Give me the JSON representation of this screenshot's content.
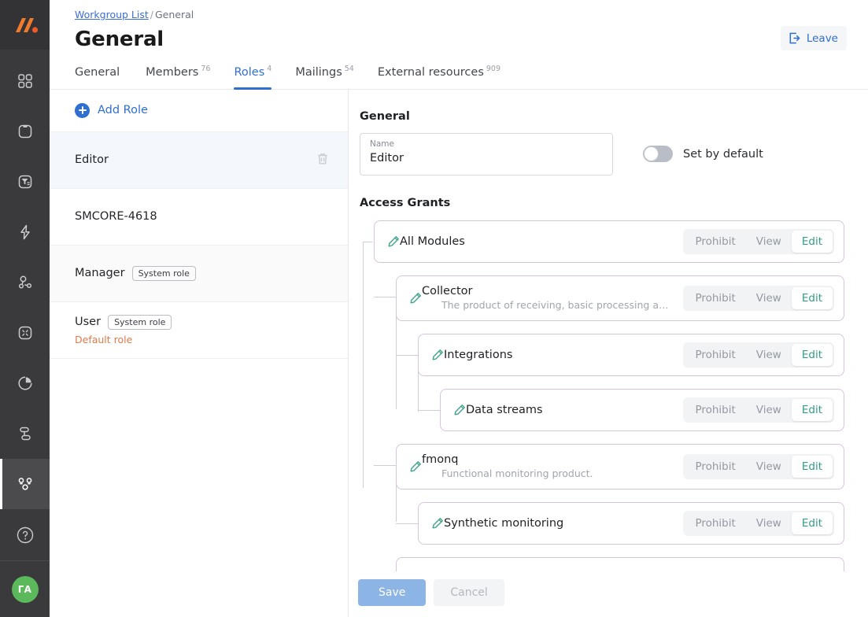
{
  "rail": {
    "logo_name": "monq-logo",
    "items": [
      {
        "name": "apps-grid-icon",
        "label": "Apps"
      },
      {
        "name": "box-icon",
        "label": "Products"
      },
      {
        "name": "filter-list-icon",
        "label": "Filters"
      },
      {
        "name": "lightning-bolt-icon",
        "label": "Automation"
      },
      {
        "name": "share-nodes-icon",
        "label": "Topology"
      },
      {
        "name": "collapse-arrows-icon",
        "label": "Screens"
      },
      {
        "name": "pie-chart-icon",
        "label": "Analytics"
      },
      {
        "name": "sitemap-icon",
        "label": "Structure"
      },
      {
        "name": "users-group-icon",
        "label": "Workgroups"
      }
    ],
    "active_index": 8,
    "help_icon": "question-circle-icon",
    "avatar_initials": "ГА",
    "avatar_color": "#5bb85b"
  },
  "header": {
    "breadcrumb_root": "Workgroup List",
    "breadcrumb_sep": "/",
    "breadcrumb_current": "General",
    "title": "General",
    "leave_label": "Leave",
    "leave_icon": "logout-arrow-icon",
    "accent_color": "#2f6fd0"
  },
  "tabs": [
    {
      "label": "General",
      "count": "",
      "active": false
    },
    {
      "label": "Members",
      "count": "76",
      "active": false
    },
    {
      "label": "Roles",
      "count": "4",
      "active": true
    },
    {
      "label": "Mailings",
      "count": "54",
      "active": false
    },
    {
      "label": "External resources",
      "count": "909",
      "active": false
    }
  ],
  "roles_pane": {
    "add_role_label": "Add Role",
    "add_role_icon": "plus-circle-icon",
    "delete_icon": "trash-icon",
    "system_badge": "System role",
    "default_role_label": "Default role",
    "default_role_color": "#e07a4a",
    "items": [
      {
        "name": "Editor",
        "badge": "",
        "default": "",
        "selected": true,
        "deletable": true
      },
      {
        "name": "SMCORE-4618",
        "badge": "",
        "default": "",
        "selected": false,
        "deletable": false
      },
      {
        "name": "Manager",
        "badge": "System role",
        "default": "",
        "selected": false,
        "deletable": false
      },
      {
        "name": "User",
        "badge": "System role",
        "default": "Default role",
        "selected": false,
        "deletable": false
      }
    ]
  },
  "detail": {
    "general_title": "General",
    "name_label": "Name",
    "name_value": "Editor",
    "name_placeholder": "Name",
    "toggle_label": "Set by default",
    "toggle_on": false,
    "access_grants_title": "Access Grants",
    "pencil_icon": "pencil-edit-icon",
    "selected_color": "#2e9e84",
    "segments": [
      "Prohibit",
      "View",
      "Edit"
    ],
    "grants": [
      {
        "name": "All Modules",
        "desc": "",
        "depth": 0,
        "selected": "Edit"
      },
      {
        "name": "Collector",
        "desc": "The product of receiving, basic processing and viewing of…",
        "depth": 1,
        "selected": "Edit"
      },
      {
        "name": "Integrations",
        "desc": "",
        "depth": 2,
        "selected": "Edit"
      },
      {
        "name": "Data streams",
        "desc": "",
        "depth": 3,
        "selected": "Edit"
      },
      {
        "name": "fmonq",
        "desc": "Functional monitoring product.",
        "depth": 1,
        "selected": "Edit"
      },
      {
        "name": "Synthetic monitoring",
        "desc": "",
        "depth": 2,
        "selected": "Edit"
      }
    ]
  },
  "footer": {
    "save_label": "Save",
    "cancel_label": "Cancel"
  }
}
